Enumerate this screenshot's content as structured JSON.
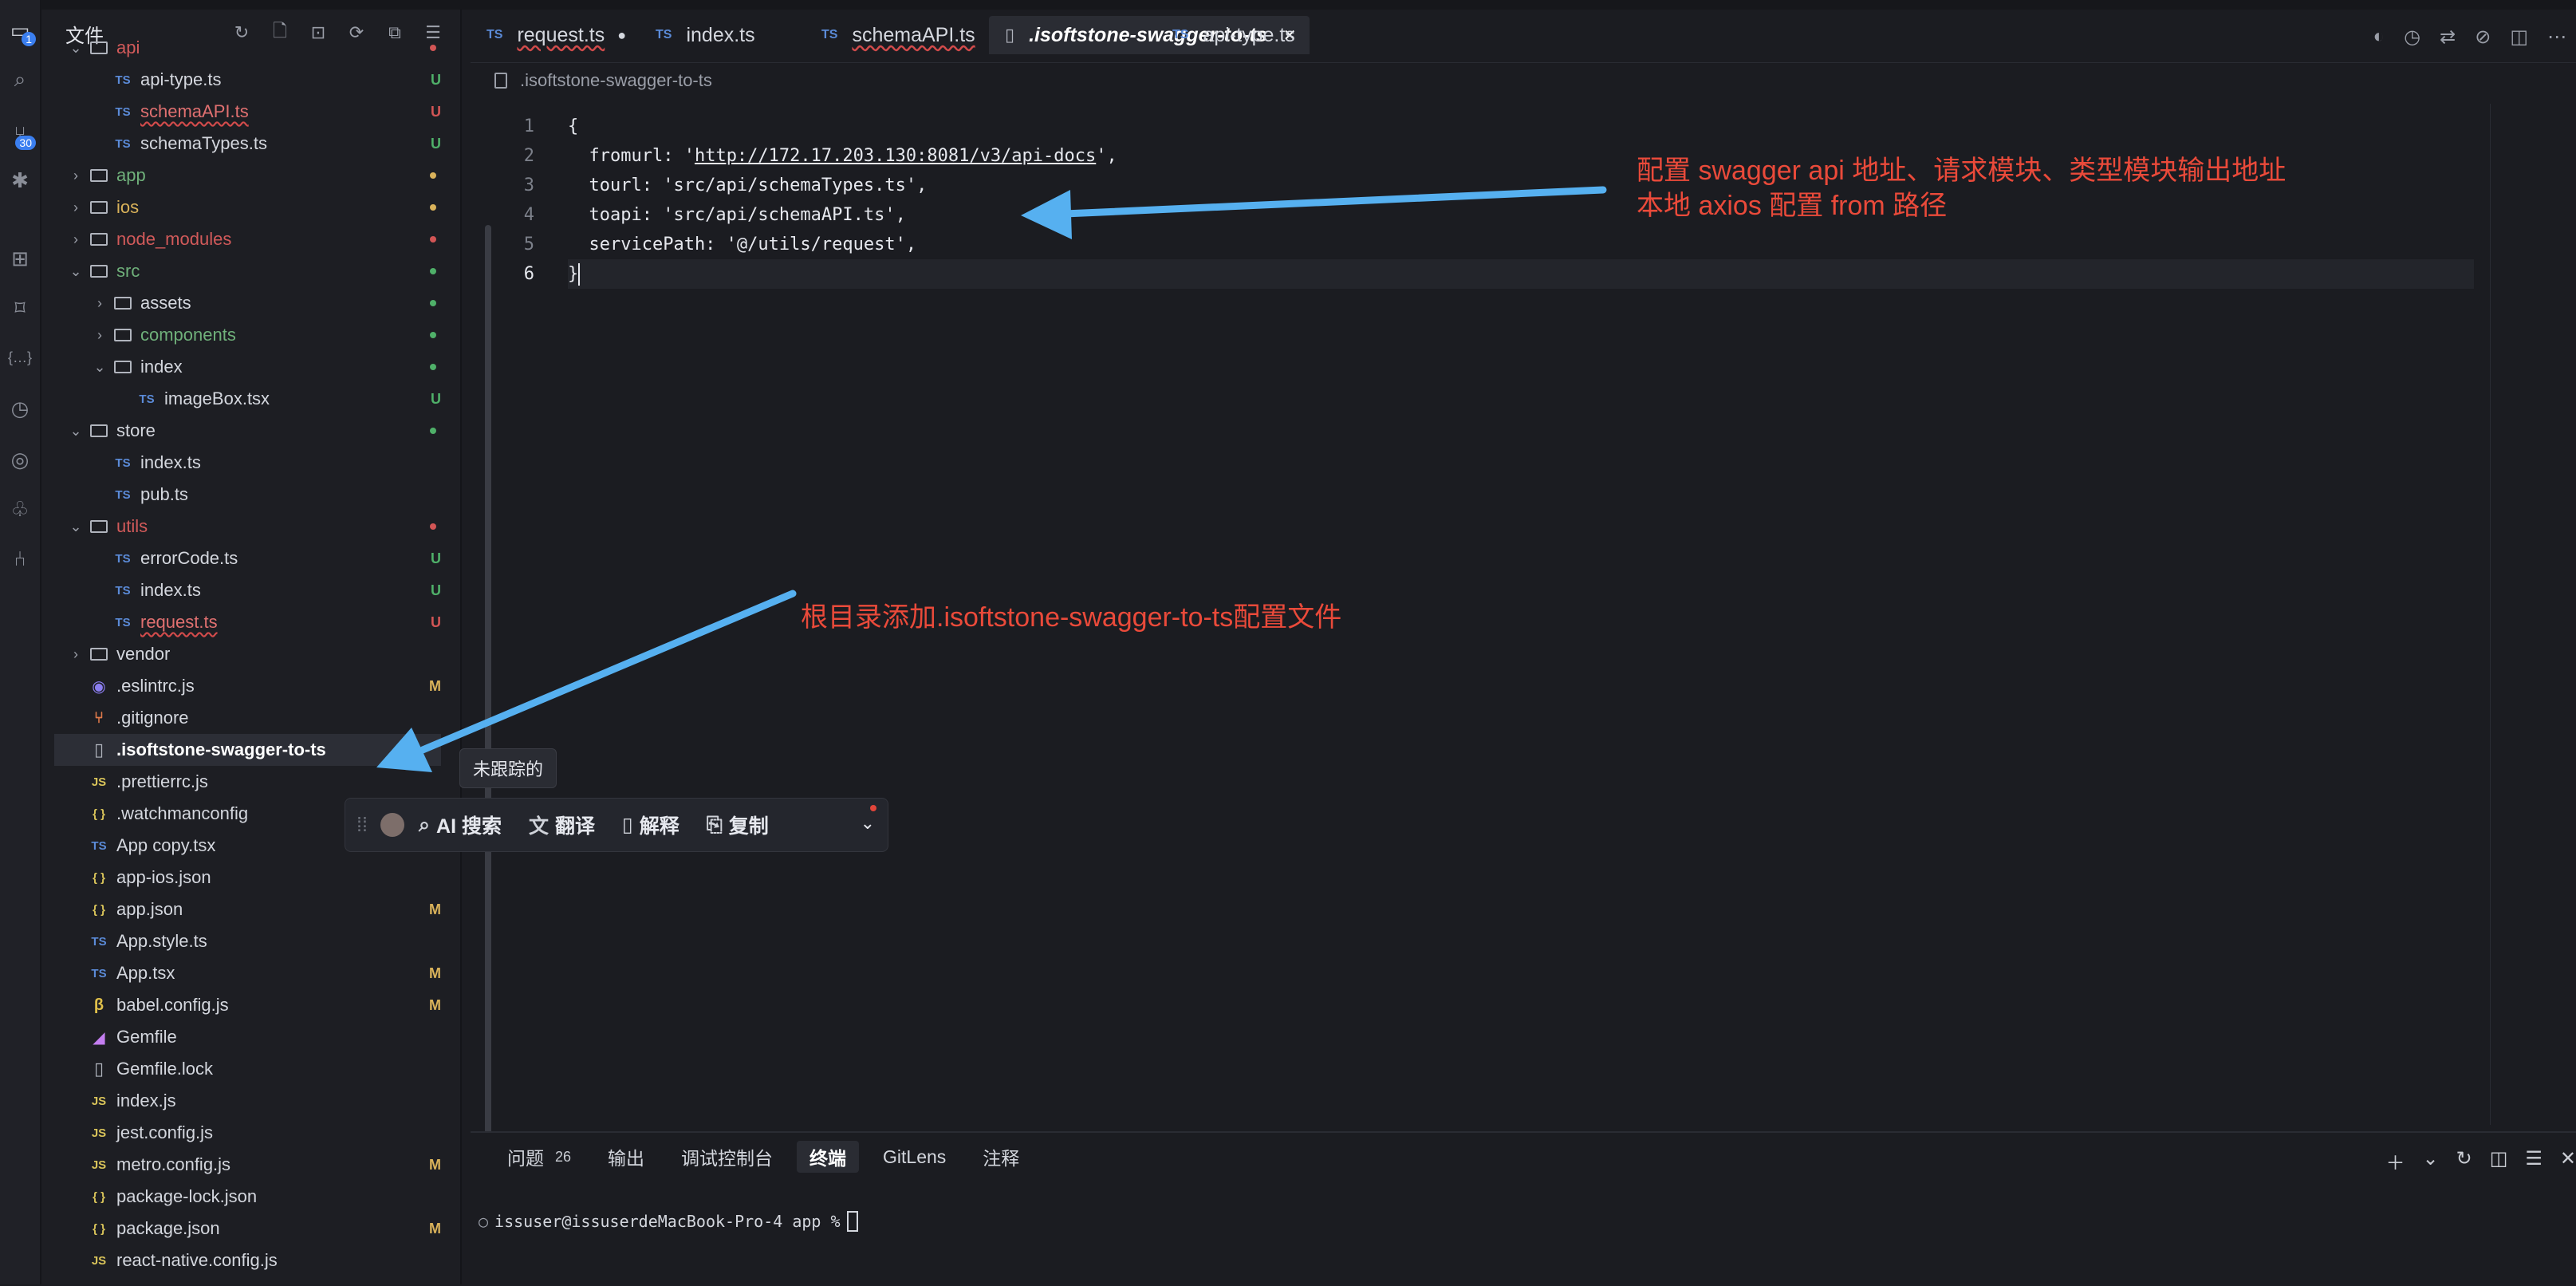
{
  "colors": {
    "untracked": "#4fb069",
    "modified": "#d9b25a",
    "deleted": "#d25555",
    "folder_untracked": "#6fb07a",
    "folder_error": "#d25a5a",
    "annotation": "#ea4a3a",
    "arrow": "#56b0f0"
  },
  "activity": {
    "explorer_badge": "1",
    "git_badge": "30"
  },
  "explorer": {
    "title": "文件",
    "toolbar_icons": [
      "refresh-icon",
      "new-file-icon",
      "new-folder-icon",
      "sync-icon",
      "collapse-icon",
      "filter-icon"
    ],
    "rows": [
      {
        "label": "api",
        "depth": 1,
        "type": "folder",
        "expanded": true,
        "color": "#d25a5a",
        "status": "dot",
        "status_color": "#d25555"
      },
      {
        "label": "api-type.ts",
        "depth": 2,
        "type": "ts",
        "status": "U",
        "status_color": "#4fb069"
      },
      {
        "label": "schemaAPI.ts",
        "depth": 2,
        "type": "ts",
        "color": "#e07070",
        "status": "U",
        "status_color": "#d25555",
        "wavy": true
      },
      {
        "label": "schemaTypes.ts",
        "depth": 2,
        "type": "ts",
        "status": "U",
        "status_color": "#4fb069"
      },
      {
        "label": "app",
        "depth": 1,
        "type": "folder",
        "expanded": false,
        "color": "#6fb07a",
        "status": "dot",
        "status_color": "#d9b25a"
      },
      {
        "label": "ios",
        "depth": 1,
        "type": "folder",
        "expanded": false,
        "color": "#d9b25a",
        "status": "dot",
        "status_color": "#d9b25a"
      },
      {
        "label": "node_modules",
        "depth": 1,
        "type": "folder",
        "expanded": false,
        "color": "#d25a5a",
        "status": "dot",
        "status_color": "#d25555"
      },
      {
        "label": "src",
        "depth": 1,
        "type": "folder",
        "expanded": true,
        "color": "#6fb07a",
        "status": "dot",
        "status_color": "#4fb069"
      },
      {
        "label": "assets",
        "depth": 2,
        "type": "folder",
        "expanded": false,
        "status": "dot",
        "status_color": "#4fb069"
      },
      {
        "label": "components",
        "depth": 2,
        "type": "folder",
        "expanded": false,
        "color": "#6fb07a",
        "status": "dot",
        "status_color": "#4fb069"
      },
      {
        "label": "index",
        "depth": 2,
        "type": "folder",
        "expanded": true,
        "status": "dot",
        "status_color": "#4fb069"
      },
      {
        "label": "imageBox.tsx",
        "depth": 3,
        "type": "ts",
        "status": "U",
        "status_color": "#4fb069"
      },
      {
        "label": "store",
        "depth": 1,
        "type": "folder",
        "expanded": true,
        "status": "dot",
        "status_color": "#4fb069"
      },
      {
        "label": "index.ts",
        "depth": 2,
        "type": "ts"
      },
      {
        "label": "pub.ts",
        "depth": 2,
        "type": "ts"
      },
      {
        "label": "utils",
        "depth": 1,
        "type": "folder",
        "expanded": true,
        "color": "#d25a5a",
        "status": "dot",
        "status_color": "#d25555"
      },
      {
        "label": "errorCode.ts",
        "depth": 2,
        "type": "ts",
        "status": "U",
        "status_color": "#4fb069"
      },
      {
        "label": "index.ts",
        "depth": 2,
        "type": "ts",
        "status": "U",
        "status_color": "#4fb069"
      },
      {
        "label": "request.ts",
        "depth": 2,
        "type": "ts",
        "color": "#e07070",
        "status": "U",
        "status_color": "#d25555",
        "wavy": true
      },
      {
        "label": "vendor",
        "depth": 1,
        "type": "folder",
        "expanded": false
      },
      {
        "label": ".eslintrc.js",
        "depth": 1,
        "type": "eslint",
        "status": "M",
        "status_color": "#d9b25a"
      },
      {
        "label": ".gitignore",
        "depth": 1,
        "type": "git"
      },
      {
        "label": ".isoftstone-swagger-to-ts",
        "depth": 1,
        "type": "file",
        "selected": true,
        "bold": true
      },
      {
        "label": ".prettierrc.js",
        "depth": 1,
        "type": "js"
      },
      {
        "label": ".watchmanconfig",
        "depth": 1,
        "type": "json"
      },
      {
        "label": "App copy.tsx",
        "depth": 1,
        "type": "ts"
      },
      {
        "label": "app-ios.json",
        "depth": 1,
        "type": "json"
      },
      {
        "label": "app.json",
        "depth": 1,
        "type": "json",
        "status": "M",
        "status_color": "#d9b25a"
      },
      {
        "label": "App.style.ts",
        "depth": 1,
        "type": "ts"
      },
      {
        "label": "App.tsx",
        "depth": 1,
        "type": "ts",
        "status": "M",
        "status_color": "#d9b25a"
      },
      {
        "label": "babel.config.js",
        "depth": 1,
        "type": "babel",
        "status": "M",
        "status_color": "#d9b25a"
      },
      {
        "label": "Gemfile",
        "depth": 1,
        "type": "gem"
      },
      {
        "label": "Gemfile.lock",
        "depth": 1,
        "type": "file"
      },
      {
        "label": "index.js",
        "depth": 1,
        "type": "js"
      },
      {
        "label": "jest.config.js",
        "depth": 1,
        "type": "js"
      },
      {
        "label": "metro.config.js",
        "depth": 1,
        "type": "js",
        "status": "M",
        "status_color": "#d9b25a"
      },
      {
        "label": "package-lock.json",
        "depth": 1,
        "type": "json"
      },
      {
        "label": "package.json",
        "depth": 1,
        "type": "json",
        "status": "M",
        "status_color": "#d9b25a"
      },
      {
        "label": "react-native.config.js",
        "depth": 1,
        "type": "js"
      }
    ],
    "tooltip": "未跟踪的"
  },
  "tabs": [
    {
      "label": "request.ts",
      "icon": "TS",
      "wavy": true,
      "dirty": true
    },
    {
      "label": "index.ts",
      "icon": "TS"
    },
    {
      "label": "schemaAPI.ts",
      "icon": "TS",
      "wavy": true
    },
    {
      "label": ".isoftstone-swagger-to-ts",
      "icon": "file",
      "active": true
    },
    {
      "label": "api-type.ts",
      "icon": "TS"
    }
  ],
  "breadcrumb": ".isoftstone-swagger-to-ts",
  "editor": {
    "lines": [
      {
        "n": "1",
        "parts": [
          {
            "t": "{"
          }
        ]
      },
      {
        "n": "2",
        "parts": [
          {
            "t": "  fromurl: '"
          },
          {
            "t": "http://172.17.203.130:8081/v3/api-docs",
            "url": true
          },
          {
            "t": "',"
          }
        ]
      },
      {
        "n": "3",
        "parts": [
          {
            "t": "  tourl: 'src/api/schemaTypes.ts',"
          }
        ]
      },
      {
        "n": "4",
        "parts": [
          {
            "t": "  toapi: 'src/api/schemaAPI.ts',"
          }
        ]
      },
      {
        "n": "5",
        "parts": [
          {
            "t": "  servicePath: '@/utils/request',"
          }
        ]
      },
      {
        "n": "6",
        "parts": [
          {
            "t": "}"
          }
        ],
        "current": true
      }
    ]
  },
  "annotations": {
    "top_line1": "配置 swagger api 地址、请求模块、类型模块输出地址",
    "top_line2": "本地 axios 配置 from 路径",
    "mid": "根目录添加.isoftstone-swagger-to-ts配置文件"
  },
  "ai_toolbar": {
    "search": "AI 搜索",
    "translate": "翻译",
    "explain": "解释",
    "copy": "复制"
  },
  "panel": {
    "tabs": [
      {
        "label": "问题",
        "count": "26"
      },
      {
        "label": "输出"
      },
      {
        "label": "调试控制台"
      },
      {
        "label": "终端",
        "active": true
      },
      {
        "label": "GitLens"
      },
      {
        "label": "注释"
      }
    ],
    "terminal_prompt": "issuser@issuserdeMacBook-Pro-4 app % "
  }
}
